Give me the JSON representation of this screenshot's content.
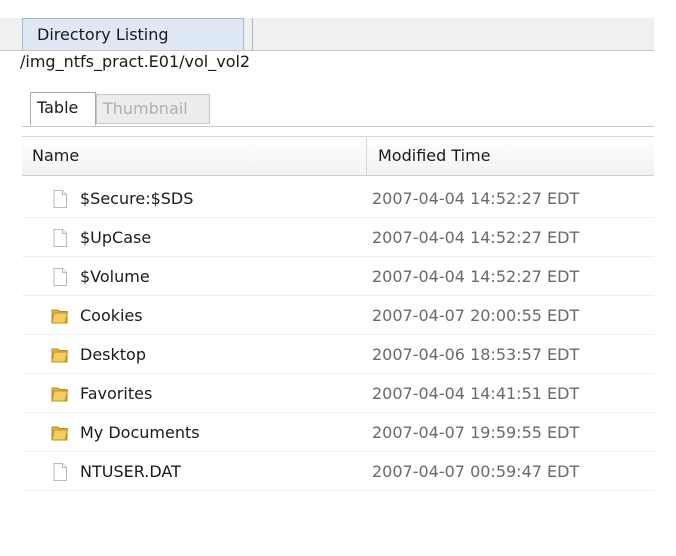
{
  "top_tab": {
    "label": "Directory Listing"
  },
  "path": "/img_ntfs_pract.E01/vol_vol2",
  "subtabs": {
    "table": "Table",
    "thumbnail": "Thumbnail"
  },
  "table": {
    "columns": [
      "Name",
      "Modified Time"
    ],
    "rows": [
      {
        "name": "$Secure:$SDS",
        "modified": "2007-04-04 14:52:27 EDT",
        "icon": "file-icon"
      },
      {
        "name": "$UpCase",
        "modified": "2007-04-04 14:52:27 EDT",
        "icon": "file-icon"
      },
      {
        "name": "$Volume",
        "modified": "2007-04-04 14:52:27 EDT",
        "icon": "file-icon"
      },
      {
        "name": "Cookies",
        "modified": "2007-04-07 20:00:55 EDT",
        "icon": "folder-icon"
      },
      {
        "name": "Desktop",
        "modified": "2007-04-06 18:53:57 EDT",
        "icon": "folder-icon"
      },
      {
        "name": "Favorites",
        "modified": "2007-04-04 14:41:51 EDT",
        "icon": "folder-icon"
      },
      {
        "name": "My Documents",
        "modified": "2007-04-07 19:59:55 EDT",
        "icon": "folder-icon"
      },
      {
        "name": "NTUSER.DAT",
        "modified": "2007-04-07 00:59:47 EDT",
        "icon": "file-icon"
      }
    ]
  },
  "colors": {
    "folder": "#e8b53c",
    "tab_active_bg": "#dfe9f5",
    "time_text": "#6a6a6a"
  }
}
